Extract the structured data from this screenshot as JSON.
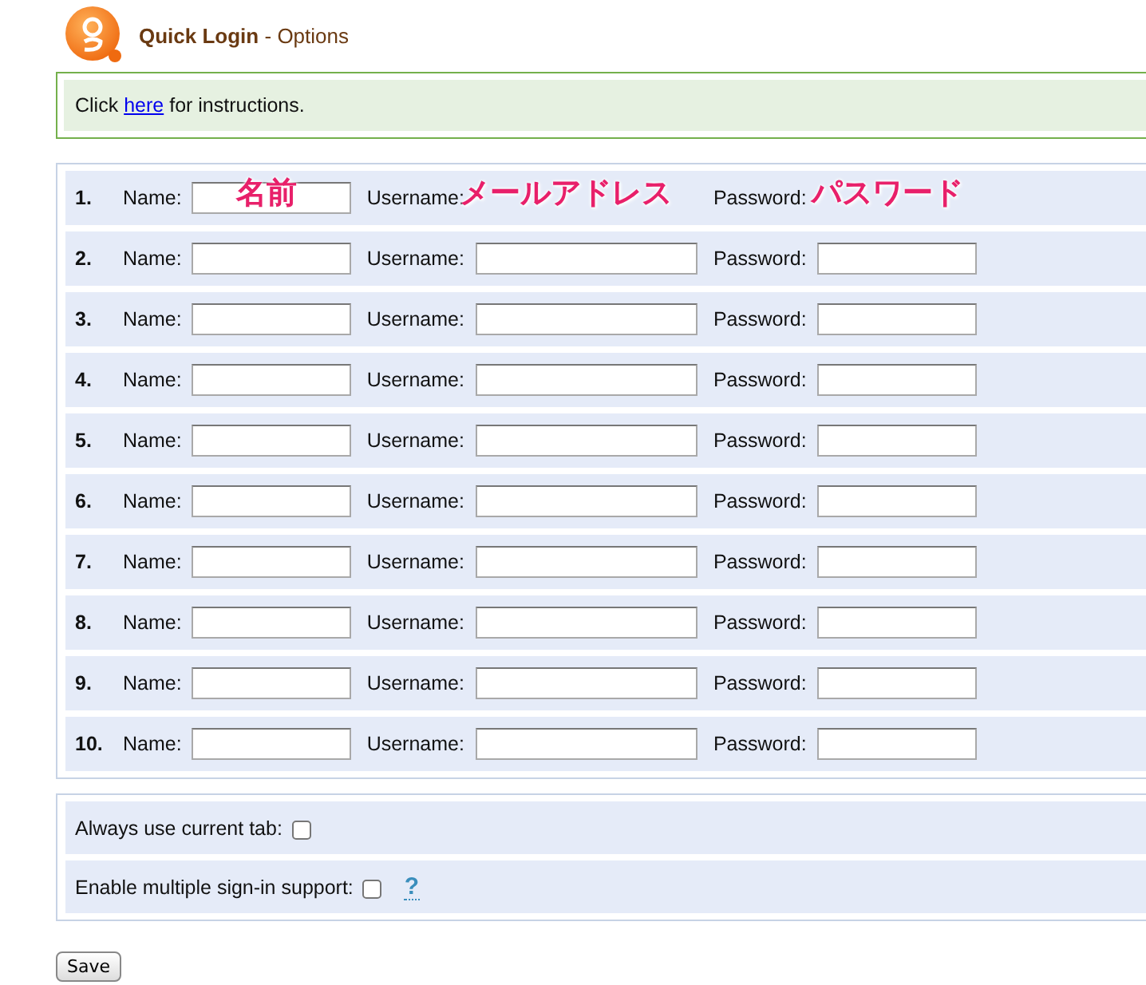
{
  "header": {
    "title": "Quick Login",
    "subtitle": "- Options"
  },
  "notice": {
    "before": "Click",
    "link": "here",
    "after": "for instructions."
  },
  "rows": [
    {
      "number": "1.",
      "fields": [
        {
          "label": "Name:",
          "covered": false,
          "annotation": "名前"
        },
        {
          "label": "Username:",
          "covered": true,
          "annotation": "メールアドレス"
        },
        {
          "label": "Password:",
          "covered": true,
          "annotation": "パスワード"
        }
      ]
    },
    {
      "number": "2.",
      "fields": [
        {
          "label": "Name:",
          "covered": false
        },
        {
          "label": "Username:",
          "covered": false
        },
        {
          "label": "Password:",
          "covered": false
        }
      ]
    },
    {
      "number": "3.",
      "fields": [
        {
          "label": "Name:",
          "covered": false
        },
        {
          "label": "Username:",
          "covered": false
        },
        {
          "label": "Password:",
          "covered": false
        }
      ]
    },
    {
      "number": "4.",
      "fields": [
        {
          "label": "Name:",
          "covered": false
        },
        {
          "label": "Username:",
          "covered": false
        },
        {
          "label": "Password:",
          "covered": false
        }
      ]
    },
    {
      "number": "5.",
      "fields": [
        {
          "label": "Name:",
          "covered": false
        },
        {
          "label": "Username:",
          "covered": false
        },
        {
          "label": "Password:",
          "covered": false
        }
      ]
    },
    {
      "number": "6.",
      "fields": [
        {
          "label": "Name:",
          "covered": false
        },
        {
          "label": "Username:",
          "covered": false
        },
        {
          "label": "Password:",
          "covered": false
        }
      ]
    },
    {
      "number": "7.",
      "fields": [
        {
          "label": "Name:",
          "covered": false
        },
        {
          "label": "Username:",
          "covered": false
        },
        {
          "label": "Password:",
          "covered": false
        }
      ]
    },
    {
      "number": "8.",
      "fields": [
        {
          "label": "Name:",
          "covered": false
        },
        {
          "label": "Username:",
          "covered": false
        },
        {
          "label": "Password:",
          "covered": false
        }
      ]
    },
    {
      "number": "9.",
      "fields": [
        {
          "label": "Name:",
          "covered": false
        },
        {
          "label": "Username:",
          "covered": false
        },
        {
          "label": "Password:",
          "covered": false
        }
      ]
    },
    {
      "number": "10.",
      "fields": [
        {
          "label": "Name:",
          "covered": false
        },
        {
          "label": "Username:",
          "covered": false
        },
        {
          "label": "Password:",
          "covered": false
        }
      ]
    }
  ],
  "options": [
    {
      "label": "Always use current tab:",
      "checked": false
    },
    {
      "label": "Enable multiple sign-in support:",
      "checked": false,
      "help": "?"
    }
  ],
  "save": "Save"
}
